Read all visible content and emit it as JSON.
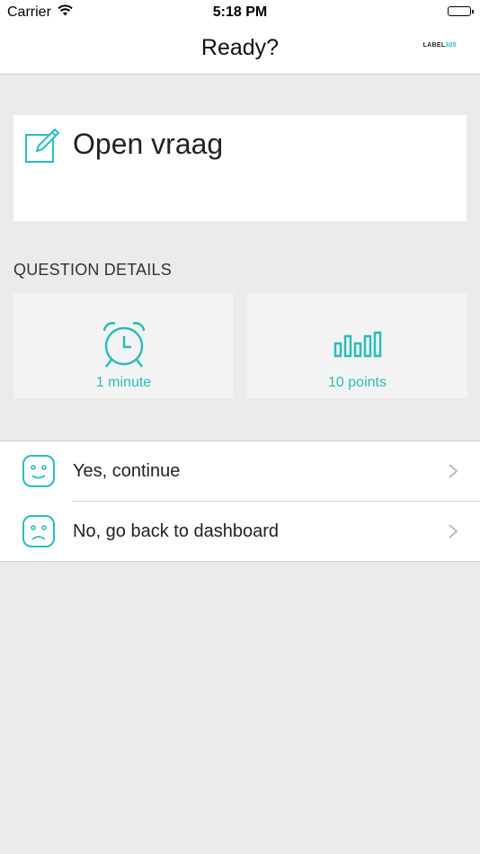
{
  "status_bar": {
    "carrier": "Carrier",
    "time": "5:18 PM"
  },
  "nav": {
    "title": "Ready?",
    "logo_text": "LABEL",
    "logo_accent": "305"
  },
  "question": {
    "title": "Open vraag",
    "icon": "edit-icon"
  },
  "details": {
    "header": "QUESTION DETAILS",
    "time_label": "1 minute",
    "time_icon": "alarm-clock-icon",
    "points_label": "10 points",
    "points_icon": "bar-chart-icon"
  },
  "actions": [
    {
      "label": "Yes, continue",
      "icon": "happy-face-icon"
    },
    {
      "label": "No, go back to dashboard",
      "icon": "sad-face-icon"
    }
  ],
  "colors": {
    "accent": "#2bbcbc",
    "background": "#ebebeb",
    "card": "#ffffff",
    "tile": "#f3f3f3"
  }
}
